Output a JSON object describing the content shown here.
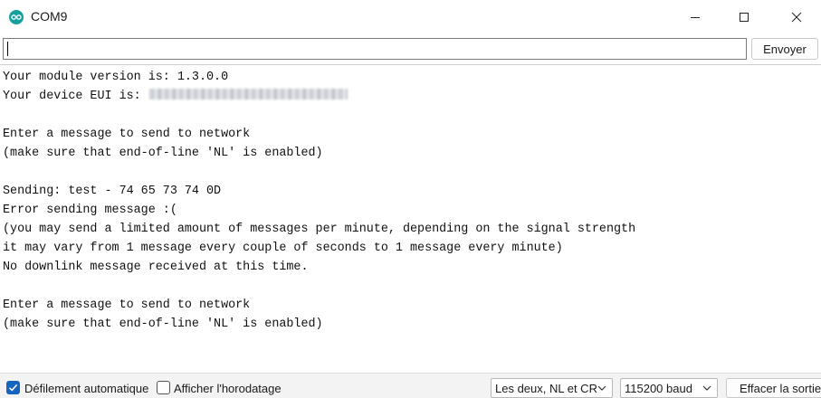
{
  "window": {
    "title": "COM9",
    "icon": "arduino-icon",
    "controls": [
      "minimize-icon",
      "maximize-icon",
      "close-icon"
    ]
  },
  "input_bar": {
    "value": "",
    "send_label": "Envoyer"
  },
  "output": {
    "lines": [
      "Your module version is: 1.3.0.0",
      "Your device EUI is: ",
      "",
      "Enter a message to send to network",
      "(make sure that end-of-line 'NL' is enabled)",
      "",
      "Sending: test - 74 65 73 74 0D",
      "Error sending message :(",
      "(you may send a limited amount of messages per minute, depending on the signal strength",
      "it may vary from 1 message every couple of seconds to 1 message every minute)",
      "No downlink message received at this time.",
      "",
      "Enter a message to send to network",
      "(make sure that end-of-line 'NL' is enabled)"
    ]
  },
  "status_bar": {
    "autoscroll_label": "Défilement automatique",
    "autoscroll_checked": true,
    "timestamp_label": "Afficher l'horodatage",
    "timestamp_checked": false,
    "line_ending": "Les deux, NL et CR",
    "baud_rate": "115200 baud",
    "clear_label": "Effacer la sortie"
  },
  "colors": {
    "accent": "#1565c0",
    "app_icon": "#15a0a0"
  }
}
